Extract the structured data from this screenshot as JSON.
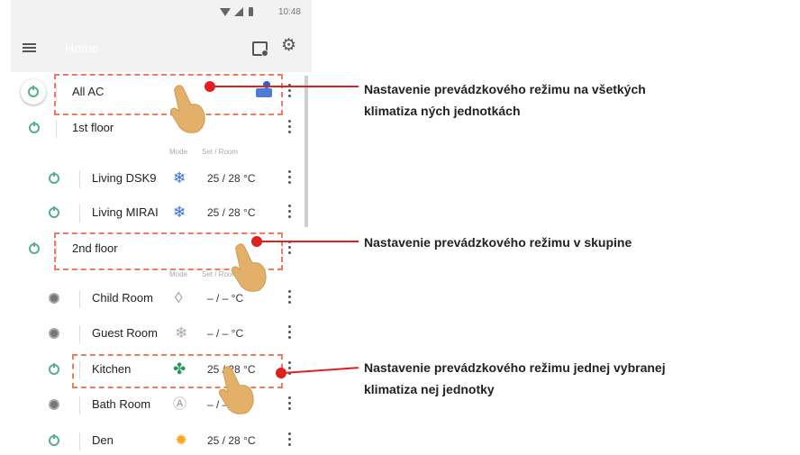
{
  "status_bar": {
    "time": "10:48"
  },
  "toolbar": {
    "title": "Home"
  },
  "headers": {
    "mode": "Mode",
    "set_room": "Set / Room"
  },
  "rows": [
    {
      "label": "All AC"
    },
    {
      "label": "1st floor"
    },
    {
      "label": "Living DSK9",
      "temp": "25 / 28  °C",
      "mode": "cool"
    },
    {
      "label": "Living MIRAI",
      "temp": "25 / 28  °C",
      "mode": "cool"
    },
    {
      "label": "2nd floor"
    },
    {
      "label": "Child Room",
      "temp": "– / –  °C",
      "mode": "dry"
    },
    {
      "label": "Guest Room",
      "temp": "– / –  °C",
      "mode": "cool"
    },
    {
      "label": "Kitchen",
      "temp": "25 / 28  °C",
      "mode": "fan"
    },
    {
      "label": "Bath Room",
      "temp": "– / –  °C",
      "mode": "auto"
    },
    {
      "label": "Den",
      "temp": "25 / 28  °C",
      "mode": "heat"
    }
  ],
  "callouts": {
    "all_line1": "Nastavenie prevádzkového režimu na všetkých",
    "all_line2": "klimatiza  ných jednotkách",
    "group": "Nastavenie prevádzkového režimu  v skupine",
    "single_line1": "Nastavenie prevádzkového režimu jednej vybranej",
    "single_line2": "klimatiza  nej jednotky"
  },
  "colors": {
    "accent_red": "#e02020",
    "dash_orange": "#f07c60",
    "power_green": "#55b08a",
    "cool_blue": "#2f6fd6",
    "fan_green": "#1e9a5a",
    "heat_orange": "#f5a623"
  },
  "icons": [
    "menu-icon",
    "calendar-icon",
    "gear-icon",
    "power-icon",
    "snowflake-icon",
    "droplet-icon",
    "fan-icon",
    "auto-mode-icon",
    "sun-icon",
    "kebab-menu-icon",
    "ac-unit-icon",
    "hand-pointer-icon"
  ]
}
